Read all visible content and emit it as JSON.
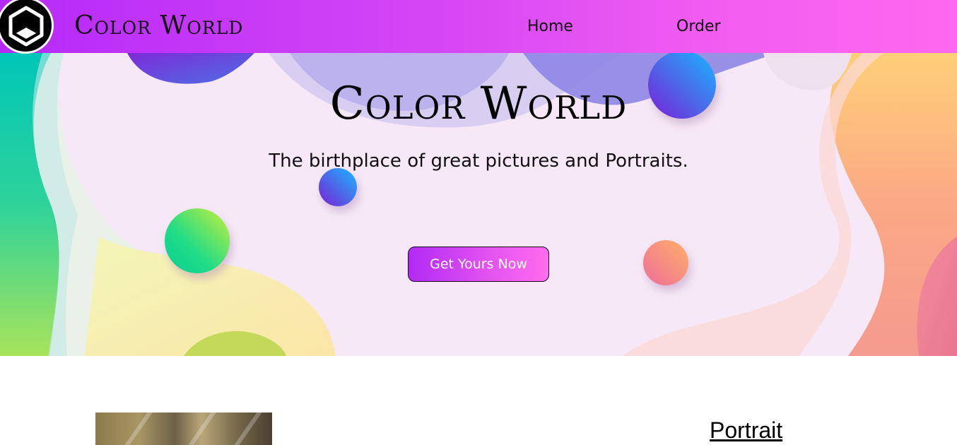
{
  "navbar": {
    "brand": "Color World",
    "logo_icon": "hexagon-logo-icon",
    "links": [
      {
        "label": "Home"
      },
      {
        "label": "Order"
      }
    ]
  },
  "hero": {
    "title": "Color World",
    "subtitle": "The birthplace of great pictures and Portraits.",
    "cta_label": "Get Yours Now"
  },
  "section": {
    "heading": "Portrait"
  },
  "colors": {
    "nav_gradient_start": "#b629f8",
    "nav_gradient_end": "#ff68ef",
    "hero_background": "#f6e8f6",
    "cta_gradient_start": "#b22af6",
    "cta_gradient_end": "#ff6cee"
  }
}
